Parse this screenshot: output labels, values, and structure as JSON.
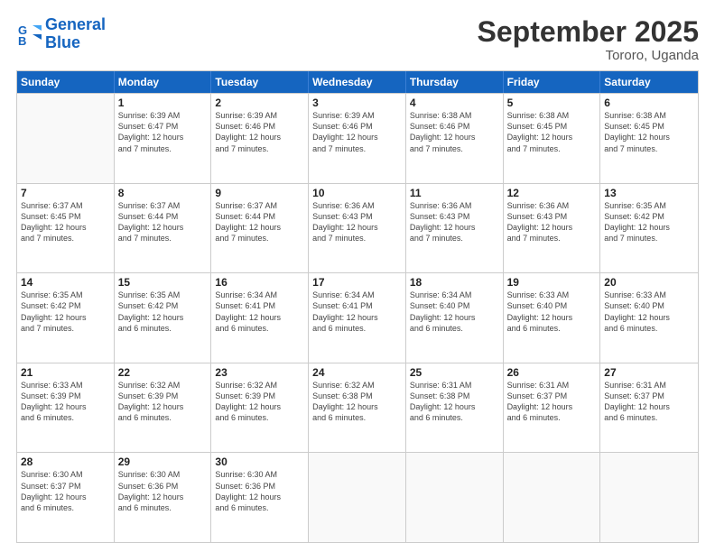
{
  "logo": {
    "line1": "General",
    "line2": "Blue"
  },
  "title": "September 2025",
  "location": "Tororo, Uganda",
  "header_days": [
    "Sunday",
    "Monday",
    "Tuesday",
    "Wednesday",
    "Thursday",
    "Friday",
    "Saturday"
  ],
  "weeks": [
    [
      {
        "day": "",
        "info": ""
      },
      {
        "day": "1",
        "info": "Sunrise: 6:39 AM\nSunset: 6:47 PM\nDaylight: 12 hours\nand 7 minutes."
      },
      {
        "day": "2",
        "info": "Sunrise: 6:39 AM\nSunset: 6:46 PM\nDaylight: 12 hours\nand 7 minutes."
      },
      {
        "day": "3",
        "info": "Sunrise: 6:39 AM\nSunset: 6:46 PM\nDaylight: 12 hours\nand 7 minutes."
      },
      {
        "day": "4",
        "info": "Sunrise: 6:38 AM\nSunset: 6:46 PM\nDaylight: 12 hours\nand 7 minutes."
      },
      {
        "day": "5",
        "info": "Sunrise: 6:38 AM\nSunset: 6:45 PM\nDaylight: 12 hours\nand 7 minutes."
      },
      {
        "day": "6",
        "info": "Sunrise: 6:38 AM\nSunset: 6:45 PM\nDaylight: 12 hours\nand 7 minutes."
      }
    ],
    [
      {
        "day": "7",
        "info": "Sunrise: 6:37 AM\nSunset: 6:45 PM\nDaylight: 12 hours\nand 7 minutes."
      },
      {
        "day": "8",
        "info": "Sunrise: 6:37 AM\nSunset: 6:44 PM\nDaylight: 12 hours\nand 7 minutes."
      },
      {
        "day": "9",
        "info": "Sunrise: 6:37 AM\nSunset: 6:44 PM\nDaylight: 12 hours\nand 7 minutes."
      },
      {
        "day": "10",
        "info": "Sunrise: 6:36 AM\nSunset: 6:43 PM\nDaylight: 12 hours\nand 7 minutes."
      },
      {
        "day": "11",
        "info": "Sunrise: 6:36 AM\nSunset: 6:43 PM\nDaylight: 12 hours\nand 7 minutes."
      },
      {
        "day": "12",
        "info": "Sunrise: 6:36 AM\nSunset: 6:43 PM\nDaylight: 12 hours\nand 7 minutes."
      },
      {
        "day": "13",
        "info": "Sunrise: 6:35 AM\nSunset: 6:42 PM\nDaylight: 12 hours\nand 7 minutes."
      }
    ],
    [
      {
        "day": "14",
        "info": "Sunrise: 6:35 AM\nSunset: 6:42 PM\nDaylight: 12 hours\nand 7 minutes."
      },
      {
        "day": "15",
        "info": "Sunrise: 6:35 AM\nSunset: 6:42 PM\nDaylight: 12 hours\nand 6 minutes."
      },
      {
        "day": "16",
        "info": "Sunrise: 6:34 AM\nSunset: 6:41 PM\nDaylight: 12 hours\nand 6 minutes."
      },
      {
        "day": "17",
        "info": "Sunrise: 6:34 AM\nSunset: 6:41 PM\nDaylight: 12 hours\nand 6 minutes."
      },
      {
        "day": "18",
        "info": "Sunrise: 6:34 AM\nSunset: 6:40 PM\nDaylight: 12 hours\nand 6 minutes."
      },
      {
        "day": "19",
        "info": "Sunrise: 6:33 AM\nSunset: 6:40 PM\nDaylight: 12 hours\nand 6 minutes."
      },
      {
        "day": "20",
        "info": "Sunrise: 6:33 AM\nSunset: 6:40 PM\nDaylight: 12 hours\nand 6 minutes."
      }
    ],
    [
      {
        "day": "21",
        "info": "Sunrise: 6:33 AM\nSunset: 6:39 PM\nDaylight: 12 hours\nand 6 minutes."
      },
      {
        "day": "22",
        "info": "Sunrise: 6:32 AM\nSunset: 6:39 PM\nDaylight: 12 hours\nand 6 minutes."
      },
      {
        "day": "23",
        "info": "Sunrise: 6:32 AM\nSunset: 6:39 PM\nDaylight: 12 hours\nand 6 minutes."
      },
      {
        "day": "24",
        "info": "Sunrise: 6:32 AM\nSunset: 6:38 PM\nDaylight: 12 hours\nand 6 minutes."
      },
      {
        "day": "25",
        "info": "Sunrise: 6:31 AM\nSunset: 6:38 PM\nDaylight: 12 hours\nand 6 minutes."
      },
      {
        "day": "26",
        "info": "Sunrise: 6:31 AM\nSunset: 6:37 PM\nDaylight: 12 hours\nand 6 minutes."
      },
      {
        "day": "27",
        "info": "Sunrise: 6:31 AM\nSunset: 6:37 PM\nDaylight: 12 hours\nand 6 minutes."
      }
    ],
    [
      {
        "day": "28",
        "info": "Sunrise: 6:30 AM\nSunset: 6:37 PM\nDaylight: 12 hours\nand 6 minutes."
      },
      {
        "day": "29",
        "info": "Sunrise: 6:30 AM\nSunset: 6:36 PM\nDaylight: 12 hours\nand 6 minutes."
      },
      {
        "day": "30",
        "info": "Sunrise: 6:30 AM\nSunset: 6:36 PM\nDaylight: 12 hours\nand 6 minutes."
      },
      {
        "day": "",
        "info": ""
      },
      {
        "day": "",
        "info": ""
      },
      {
        "day": "",
        "info": ""
      },
      {
        "day": "",
        "info": ""
      }
    ]
  ]
}
